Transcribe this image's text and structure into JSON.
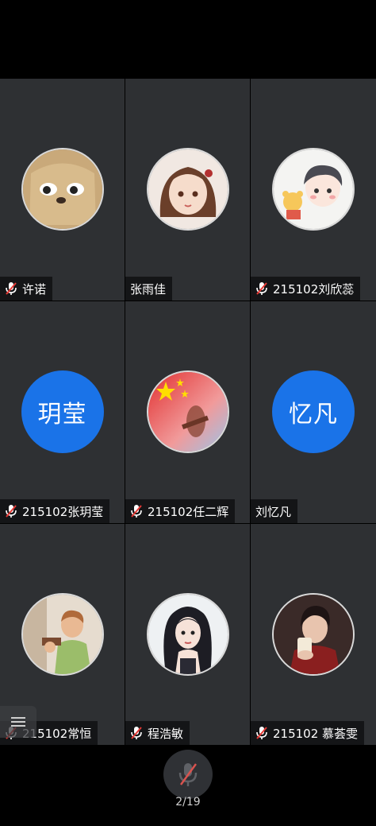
{
  "participants": [
    {
      "name": "许诺",
      "muted": true,
      "avatar": "photo",
      "avatar_desc": "bear-mask-avatar"
    },
    {
      "name": "张雨佳",
      "muted": false,
      "avatar": "photo",
      "avatar_desc": "anime-girl-avatar"
    },
    {
      "name": "215102刘欣蕊",
      "muted": true,
      "avatar": "photo",
      "avatar_desc": "cartoon-boy-avatar"
    },
    {
      "name": "215102张玥莹",
      "muted": true,
      "avatar": "text",
      "avatar_text": "玥莹"
    },
    {
      "name": "215102任二辉",
      "muted": true,
      "avatar": "photo",
      "avatar_desc": "flag-guitar-avatar"
    },
    {
      "name": "刘忆凡",
      "muted": false,
      "avatar": "text",
      "avatar_text": "忆凡"
    },
    {
      "name": "215102常恒",
      "muted": true,
      "avatar": "photo",
      "avatar_desc": "boy-photo-avatar"
    },
    {
      "name": "程浩敏",
      "muted": true,
      "avatar": "photo",
      "avatar_desc": "illustrated-girl-avatar"
    },
    {
      "name": "215102 慕荟雯",
      "muted": true,
      "avatar": "photo",
      "avatar_desc": "boy-drinking-avatar"
    }
  ],
  "controls": {
    "mic_icon": "mic-off-icon",
    "page_indicator": "2/19"
  },
  "colors": {
    "tile_bg": "#2e3033",
    "text_avatar_bg": "#1a73e8",
    "muted_icon": "#e53935"
  }
}
